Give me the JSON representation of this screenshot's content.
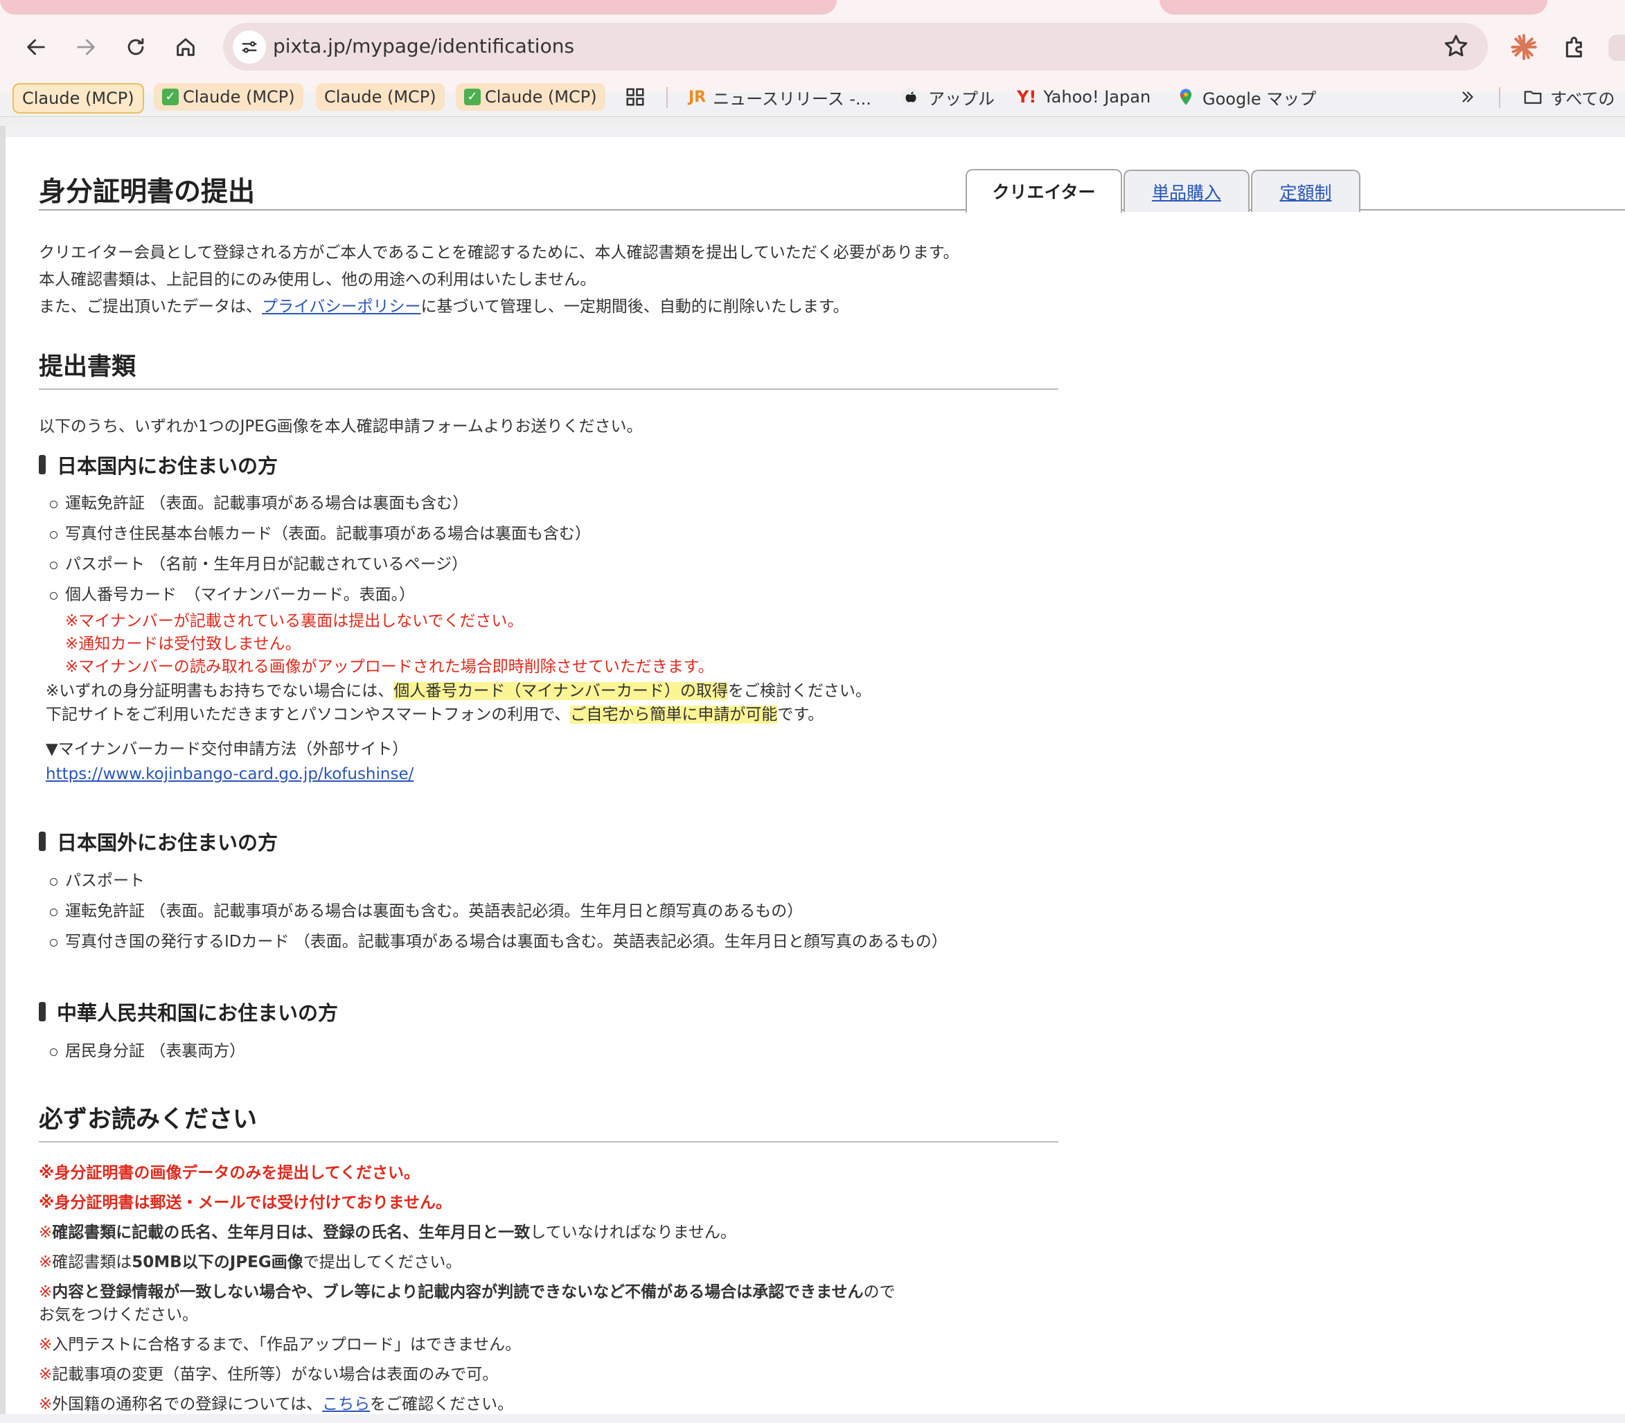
{
  "browser": {
    "url": "pixta.jp/mypage/identifications",
    "bookmarks": [
      {
        "label": "Claude (MCP)",
        "checked": false
      },
      {
        "label": "Claude (MCP)",
        "checked": true
      },
      {
        "label": "Claude (MCP)",
        "checked": false
      },
      {
        "label": "Claude (MCP)",
        "checked": true
      },
      {
        "label": "ニュースリリース -..."
      },
      {
        "label": "アップル"
      },
      {
        "label": "Yahoo! Japan"
      },
      {
        "label": "Google マップ"
      },
      {
        "label": "すべての"
      }
    ],
    "icons": [
      "back-icon",
      "forward-icon",
      "reload-icon",
      "home-icon",
      "site-info-icon",
      "bookmark-star-icon",
      "claude-icon",
      "extensions-icon",
      "apps-grid-icon",
      "chevron-double-right-icon",
      "folder-icon"
    ],
    "accent_color": "#d97757"
  },
  "page": {
    "title": "身分証明書の提出",
    "tabs": [
      {
        "label": "クリエイター",
        "active": true
      },
      {
        "label": "単品購入",
        "active": false
      },
      {
        "label": "定額制",
        "active": false
      }
    ],
    "intro": {
      "line1": "クリエイター会員として登録される方がご本人であることを確認するために、本人確認書類を提出していただく必要があります。",
      "line2": "本人確認書類は、上記目的にのみ使用し、他の用途への利用はいたしません。",
      "line3_pre": "また、ご提出頂いたデータは、",
      "line3_link": "プライバシーポリシー",
      "line3_post": "に基づいて管理し、一定期間後、自動的に削除いたします。"
    },
    "documents": {
      "heading": "提出書類",
      "lead": "以下のうち、いずれか1つのJPEG画像を本人確認申請フォームよりお送りください。",
      "domestic": {
        "heading": "日本国内にお住まいの方",
        "items": [
          "運転免許証 （表面。記載事項がある場合は裏面も含む）",
          "写真付き住民基本台帳カード（表面。記載事項がある場合は裏面も含む）",
          "パスポート （名前・生年月日が記載されているページ）",
          "個人番号カード　（マイナンバーカード。表面。）"
        ],
        "mynumber_notes": [
          "※マイナンバーが記載されている裏面は提出しないでください。",
          "※通知カードは受付致しません。",
          "※マイナンバーの読み取れる画像がアップロードされた場合即時削除させていただきます。"
        ],
        "note1_pre": "※いずれの身分証明書もお持ちでない場合には、",
        "note1_hl": "個人番号カード（マイナンバーカード）の取得",
        "note1_post": "をご検討ください。",
        "note2_pre": "下記サイトをご利用いただきますとパソコンやスマートフォンの利用で、",
        "note2_hl": "ご自宅から簡単に申請が可能",
        "note2_post": "です。",
        "external_label": "▼マイナンバーカード交付申請方法（外部サイト）",
        "external_url": "https://www.kojinbango-card.go.jp/kofushinse/"
      },
      "overseas": {
        "heading": "日本国外にお住まいの方",
        "items": [
          "パスポート",
          "運転免許証 （表面。記載事項がある場合は裏面も含む。英語表記必須。生年月日と顔写真のあるもの）",
          "写真付き国の発行するIDカード （表面。記載事項がある場合は裏面も含む。英語表記必須。生年月日と顔写真のあるもの）"
        ]
      },
      "china": {
        "heading": "中華人民共和国にお住まいの方",
        "items": [
          "居民身分証 （表裏両方）"
        ]
      }
    },
    "notice": {
      "heading": "必ずお読みください",
      "n1": "※身分証明書の画像データのみを提出してください。",
      "n2": "※身分証明書は郵送・メールでは受け付けておりません。",
      "n3_mark": "※",
      "n3_bold": "確認書類に記載の氏名、生年月日は、登録の氏名、生年月日と一致",
      "n3_rest": "していなければなりません。",
      "n4_mark": "※",
      "n4_pre": "確認書類は",
      "n4_bold": "50MB以下のJPEG画像",
      "n4_rest": "で提出してください。",
      "n5_mark": "※",
      "n5_bold": "内容と登録情報が一致しない場合や、ブレ等により記載内容が判読できないなど不備がある場合は承認できません",
      "n5_rest": "ので",
      "n5_line2": "お気をつけください。",
      "n6_mark": "※",
      "n6_rest": "入門テストに合格するまで、「作品アップロード」はできません。",
      "n7_mark": "※",
      "n7_rest": "記載事項の変更（苗字、住所等）がない場合は表面のみで可。",
      "n8_mark": "※",
      "n8_pre": "外国籍の通称名での登録については、",
      "n8_link": "こちら",
      "n8_post": "をご確認ください。"
    }
  }
}
